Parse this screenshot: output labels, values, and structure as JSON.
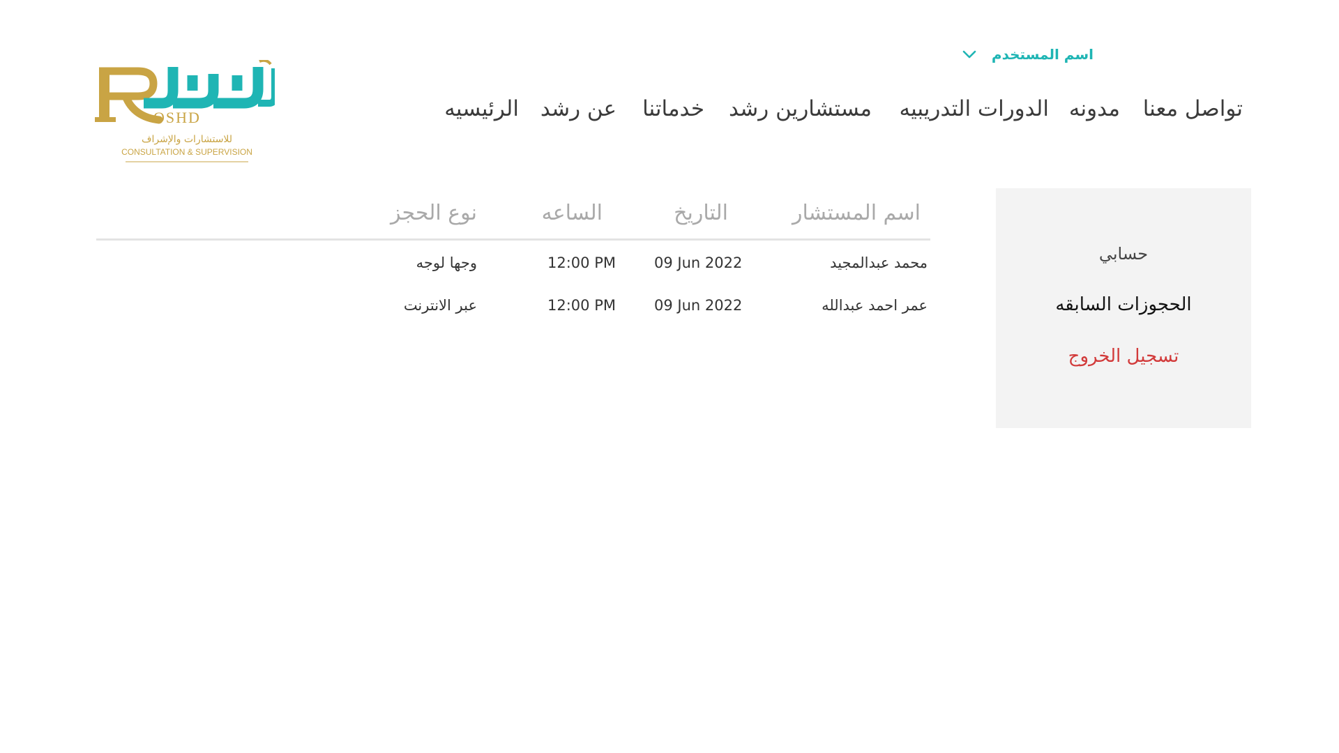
{
  "user": {
    "name": "اسم المستخدم",
    "menu_icon": "chevron-down-icon"
  },
  "nav": {
    "items": [
      {
        "id": "contact",
        "label": "تواصل معنا"
      },
      {
        "id": "blog",
        "label": "مدونه"
      },
      {
        "id": "courses",
        "label": "الدورات التدريبيه"
      },
      {
        "id": "consultants",
        "label": "مستشارين رشد"
      },
      {
        "id": "services",
        "label": "خدماتنا"
      },
      {
        "id": "about",
        "label": "عن رشد"
      },
      {
        "id": "home",
        "label": "الرئيسيه"
      }
    ]
  },
  "logo": {
    "latin": "OSHD",
    "arabic_tagline": "للاستشارات والإشراف",
    "english_tagline": "CONSULTATION & SUPERVISION"
  },
  "sidebar": {
    "account": "حسابي",
    "bookings": "الحجوزات السابقه",
    "logout": "تسجيل الخروج"
  },
  "table": {
    "headers": {
      "consultant": "اسم المستشار",
      "date": "التاريخ",
      "time": "الساعه",
      "type": "نوع الحجز"
    },
    "rows": [
      {
        "consultant": "محمد عبدالمجيد",
        "date": "09 Jun 2022",
        "time": "12:00 PM",
        "type": "وجها لوجه"
      },
      {
        "consultant": "عمر احمد عبدالله",
        "date": "09 Jun 2022",
        "time": "12:00 PM",
        "type": "عبر الانترنت"
      }
    ]
  },
  "colors": {
    "accent_teal": "#1fb5b4",
    "logo_gold": "#c9a444",
    "logout_red": "#d23a3a",
    "sidebar_bg": "#f3f3f3",
    "header_gray": "#a9a9a9"
  }
}
